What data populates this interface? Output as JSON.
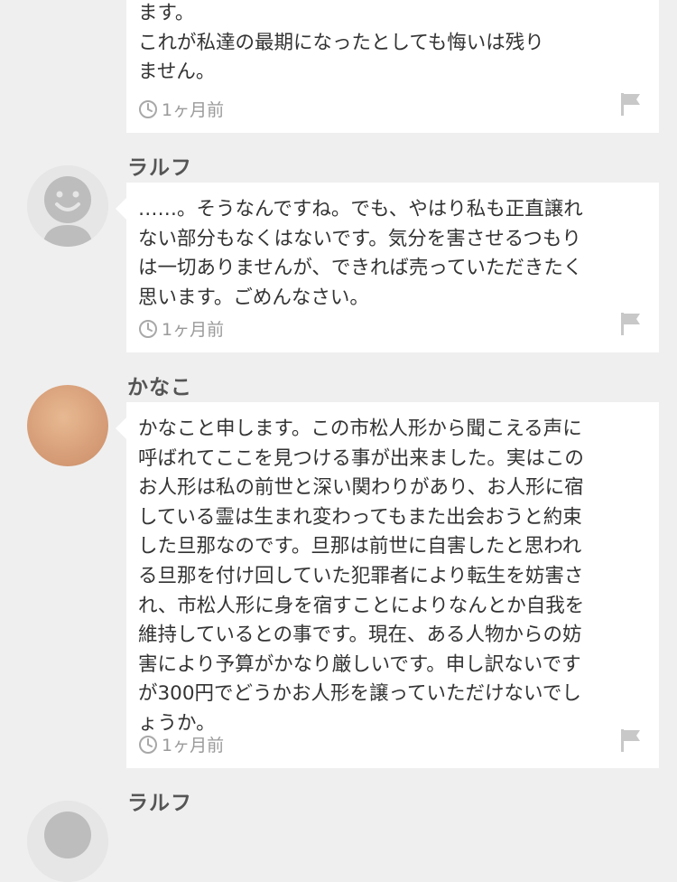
{
  "messages": [
    {
      "username": "",
      "avatar": "none",
      "lines": [
        "ます。",
        "これが私達の最期になったとしても悔いは残り",
        "ません。"
      ],
      "timestamp": "1ヶ月前",
      "icons": {
        "time": "clock-icon",
        "report": "flag-icon"
      }
    },
    {
      "username": "ラルフ",
      "avatar": "default-user-icon",
      "lines": [
        "……。そうなんですね。でも、やはり私も正直譲れ",
        "ない部分もなくはないです。気分を害させるつもり",
        "は一切ありませんが、できれば売っていただきたく",
        "思います。ごめんなさい。"
      ],
      "timestamp": "1ヶ月前",
      "icons": {
        "time": "clock-icon",
        "report": "flag-icon"
      }
    },
    {
      "username": "かなこ",
      "avatar": "photo-avatar",
      "lines": [
        "かなこと申します。この市松人形から聞こえる声に",
        "呼ばれてここを見つける事が出来ました。実はこの",
        "お人形は私の前世と深い関わりがあり、お人形に宿",
        "している霊は生まれ変わってもまた出会おうと約束",
        "した旦那なのです。旦那は前世に自害したと思われ",
        "る旦那を付け回していた犯罪者により転生を妨害さ",
        "れ、市松人形に身を宿すことによりなんとか自我を",
        "維持しているとの事です。現在、ある人物からの妨",
        "害により予算がかなり厳しいです。申し訳ないです",
        "が300円でどうかお人形を譲っていただけないでし",
        "ょうか。"
      ],
      "timestamp": "1ヶ月前",
      "icons": {
        "time": "clock-icon",
        "report": "flag-icon"
      }
    },
    {
      "username": "ラルフ",
      "avatar": "default-user-icon"
    }
  ],
  "colors": {
    "background": "#efefef",
    "bubble": "#ffffff",
    "meta_gray": "#9a9a9a",
    "username": "#555555"
  }
}
